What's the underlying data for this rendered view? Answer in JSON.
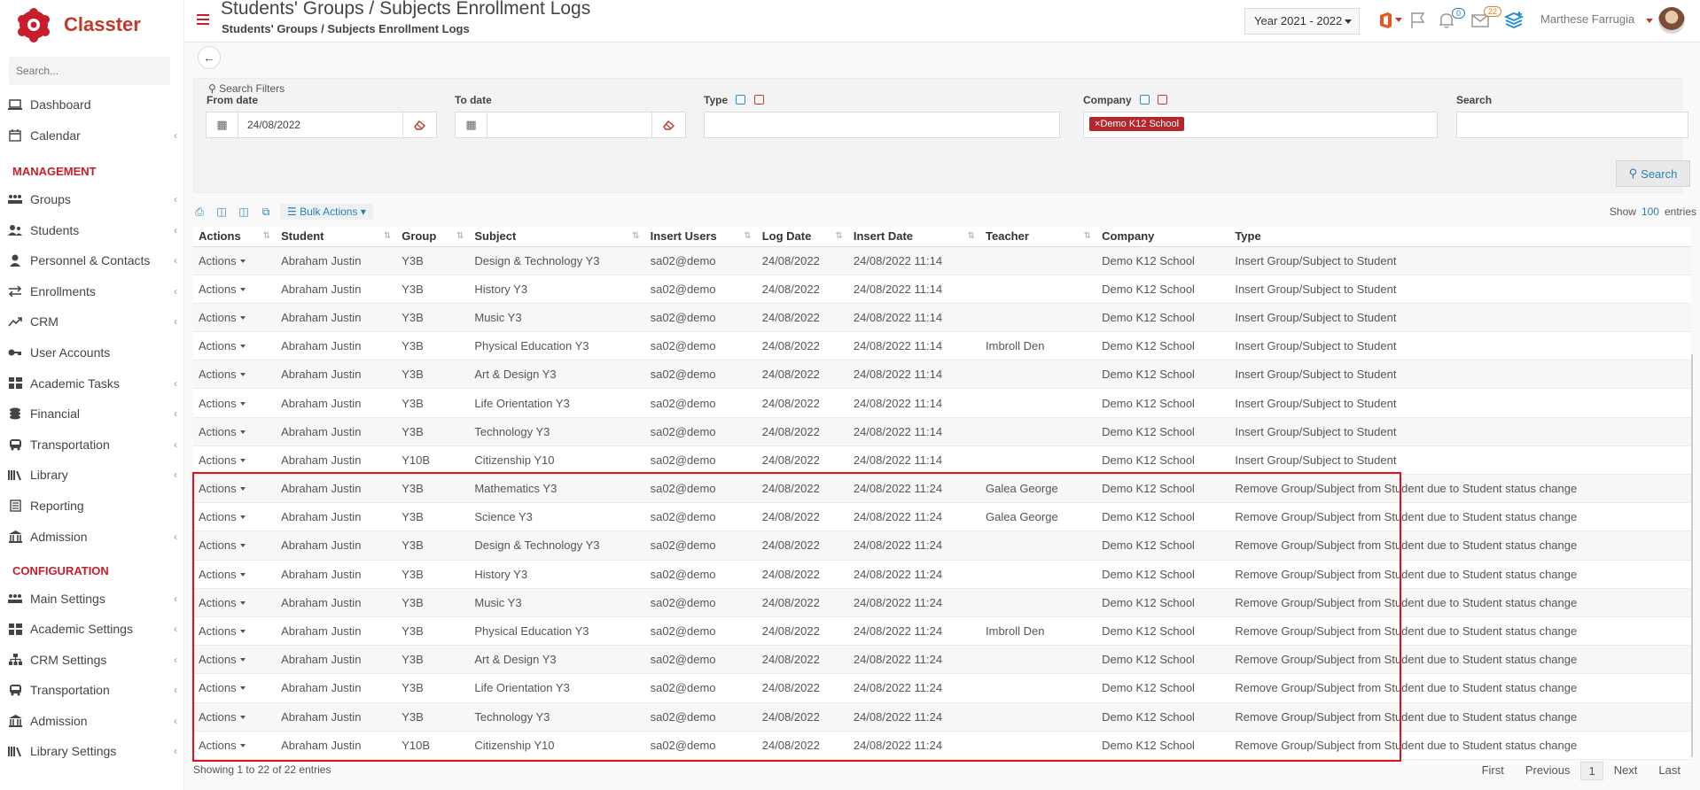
{
  "app": {
    "name": "Classter",
    "brand_color": "#c81e2b",
    "link_color": "#2a7fb4"
  },
  "sidebar": {
    "search_placeholder": "Search...",
    "top_items": [
      {
        "label": "Dashboard",
        "icon": "laptop-icon"
      },
      {
        "label": "Calendar",
        "icon": "calendar-icon"
      }
    ],
    "management_label": "MANAGEMENT",
    "management_items": [
      {
        "label": "Groups",
        "icon": "groups-icon"
      },
      {
        "label": "Students",
        "icon": "students-icon"
      },
      {
        "label": "Personnel & Contacts",
        "icon": "person-icon"
      },
      {
        "label": "Enrollments",
        "icon": "exchange-icon"
      },
      {
        "label": "CRM",
        "icon": "trend-icon"
      },
      {
        "label": "User Accounts",
        "icon": "key-icon"
      },
      {
        "label": "Academic Tasks",
        "icon": "grid-icon"
      },
      {
        "label": "Financial",
        "icon": "coins-icon"
      },
      {
        "label": "Transportation",
        "icon": "bus-icon"
      },
      {
        "label": "Library",
        "icon": "library-icon"
      },
      {
        "label": "Reporting",
        "icon": "report-icon"
      },
      {
        "label": "Admission",
        "icon": "building-icon"
      }
    ],
    "configuration_label": "CONFIGURATION",
    "configuration_items": [
      {
        "label": "Main Settings",
        "icon": "groups-icon"
      },
      {
        "label": "Academic Settings",
        "icon": "grid-icon"
      },
      {
        "label": "CRM Settings",
        "icon": "sitemap-icon"
      },
      {
        "label": "Transportation",
        "icon": "bus-icon"
      },
      {
        "label": "Admission",
        "icon": "building-icon"
      },
      {
        "label": "Library Settings",
        "icon": "library-icon"
      }
    ]
  },
  "header": {
    "title": "Students' Groups / Subjects Enrollment Logs",
    "subtitle": "Students' Groups / Subjects Enrollment Logs",
    "year": "Year 2021 - 2022",
    "notifications_count": "0",
    "messages_count": "22",
    "user_name": "Marthese Farrugia"
  },
  "filters": {
    "title": "Search Filters",
    "from_date_label": "From date",
    "from_date_value": "24/08/2022",
    "to_date_label": "To date",
    "to_date_value": "",
    "type_label": "Type",
    "company_label": "Company",
    "company_tag": "Demo K12 School",
    "search_label": "Search",
    "search_button": "Search"
  },
  "toolbar": {
    "bulk_actions": "Bulk Actions"
  },
  "table": {
    "show_label": "Show",
    "show_count": "100",
    "entries_label": "entries",
    "columns": [
      "Actions",
      "Student",
      "Group",
      "Subject",
      "Insert Users",
      "Log Date",
      "Insert Date",
      "Teacher",
      "Company",
      "Type"
    ],
    "actions_label": "Actions",
    "rows": [
      [
        "Abraham Justin",
        "Y3B",
        "Design & Technology Y3",
        "sa02@demo",
        "24/08/2022",
        "24/08/2022 11:14",
        "",
        "Demo K12 School",
        "Insert Group/Subject to Student"
      ],
      [
        "Abraham Justin",
        "Y3B",
        "History Y3",
        "sa02@demo",
        "24/08/2022",
        "24/08/2022 11:14",
        "",
        "Demo K12 School",
        "Insert Group/Subject to Student"
      ],
      [
        "Abraham Justin",
        "Y3B",
        "Music Y3",
        "sa02@demo",
        "24/08/2022",
        "24/08/2022 11:14",
        "",
        "Demo K12 School",
        "Insert Group/Subject to Student"
      ],
      [
        "Abraham Justin",
        "Y3B",
        "Physical Education Y3",
        "sa02@demo",
        "24/08/2022",
        "24/08/2022 11:14",
        "Imbroll Den",
        "Demo K12 School",
        "Insert Group/Subject to Student"
      ],
      [
        "Abraham Justin",
        "Y3B",
        "Art & Design Y3",
        "sa02@demo",
        "24/08/2022",
        "24/08/2022 11:14",
        "",
        "Demo K12 School",
        "Insert Group/Subject to Student"
      ],
      [
        "Abraham Justin",
        "Y3B",
        "Life Orientation Y3",
        "sa02@demo",
        "24/08/2022",
        "24/08/2022 11:14",
        "",
        "Demo K12 School",
        "Insert Group/Subject to Student"
      ],
      [
        "Abraham Justin",
        "Y3B",
        "Technology Y3",
        "sa02@demo",
        "24/08/2022",
        "24/08/2022 11:14",
        "",
        "Demo K12 School",
        "Insert Group/Subject to Student"
      ],
      [
        "Abraham Justin",
        "Y10B",
        "Citizenship Y10",
        "sa02@demo",
        "24/08/2022",
        "24/08/2022 11:14",
        "",
        "Demo K12 School",
        "Insert Group/Subject to Student"
      ],
      [
        "Abraham Justin",
        "Y3B",
        "Mathematics Y3",
        "sa02@demo",
        "24/08/2022",
        "24/08/2022 11:24",
        "Galea George",
        "Demo K12 School",
        "Remove Group/Subject from Student due to Student status change"
      ],
      [
        "Abraham Justin",
        "Y3B",
        "Science Y3",
        "sa02@demo",
        "24/08/2022",
        "24/08/2022 11:24",
        "Galea George",
        "Demo K12 School",
        "Remove Group/Subject from Student due to Student status change"
      ],
      [
        "Abraham Justin",
        "Y3B",
        "Design & Technology Y3",
        "sa02@demo",
        "24/08/2022",
        "24/08/2022 11:24",
        "",
        "Demo K12 School",
        "Remove Group/Subject from Student due to Student status change"
      ],
      [
        "Abraham Justin",
        "Y3B",
        "History Y3",
        "sa02@demo",
        "24/08/2022",
        "24/08/2022 11:24",
        "",
        "Demo K12 School",
        "Remove Group/Subject from Student due to Student status change"
      ],
      [
        "Abraham Justin",
        "Y3B",
        "Music Y3",
        "sa02@demo",
        "24/08/2022",
        "24/08/2022 11:24",
        "",
        "Demo K12 School",
        "Remove Group/Subject from Student due to Student status change"
      ],
      [
        "Abraham Justin",
        "Y3B",
        "Physical Education Y3",
        "sa02@demo",
        "24/08/2022",
        "24/08/2022 11:24",
        "Imbroll Den",
        "Demo K12 School",
        "Remove Group/Subject from Student due to Student status change"
      ],
      [
        "Abraham Justin",
        "Y3B",
        "Art & Design Y3",
        "sa02@demo",
        "24/08/2022",
        "24/08/2022 11:24",
        "",
        "Demo K12 School",
        "Remove Group/Subject from Student due to Student status change"
      ],
      [
        "Abraham Justin",
        "Y3B",
        "Life Orientation Y3",
        "sa02@demo",
        "24/08/2022",
        "24/08/2022 11:24",
        "",
        "Demo K12 School",
        "Remove Group/Subject from Student due to Student status change"
      ],
      [
        "Abraham Justin",
        "Y3B",
        "Technology Y3",
        "sa02@demo",
        "24/08/2022",
        "24/08/2022 11:24",
        "",
        "Demo K12 School",
        "Remove Group/Subject from Student due to Student status change"
      ],
      [
        "Abraham Justin",
        "Y10B",
        "Citizenship Y10",
        "sa02@demo",
        "24/08/2022",
        "24/08/2022 11:24",
        "",
        "Demo K12 School",
        "Remove Group/Subject from Student due to Student status change"
      ]
    ],
    "showing_text": "Showing 1 to 22 of 22 entries"
  },
  "pagination": {
    "first": "First",
    "previous": "Previous",
    "current": "1",
    "next": "Next",
    "last": "Last"
  }
}
